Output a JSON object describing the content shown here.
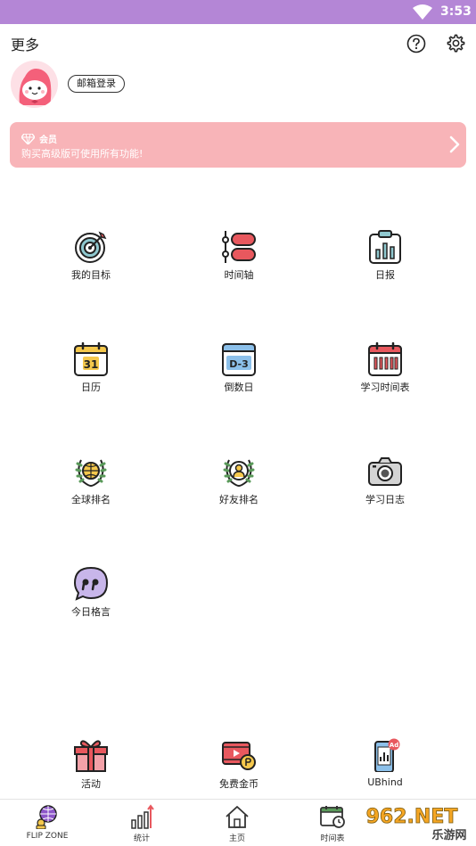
{
  "status": {
    "time": "3:53"
  },
  "header": {
    "title": "更多"
  },
  "profile": {
    "login_label": "邮箱登录"
  },
  "vip": {
    "label": "会员",
    "desc": "购买高级版可使用所有功能!"
  },
  "grid": [
    {
      "label": "我的目标",
      "icon": "target-icon"
    },
    {
      "label": "时间轴",
      "icon": "timeline-icon"
    },
    {
      "label": "日报",
      "icon": "daily-report-icon"
    },
    {
      "label": "日历",
      "icon": "calendar-icon"
    },
    {
      "label": "倒数日",
      "icon": "countdown-icon"
    },
    {
      "label": "学习时间表",
      "icon": "study-schedule-icon"
    },
    {
      "label": "全球排名",
      "icon": "global-rank-icon"
    },
    {
      "label": "好友排名",
      "icon": "friend-rank-icon"
    },
    {
      "label": "学习日志",
      "icon": "camera-icon"
    },
    {
      "label": "今日格言",
      "icon": "quote-icon"
    }
  ],
  "bottom": [
    {
      "label": "活动",
      "icon": "gift-icon"
    },
    {
      "label": "免费金币",
      "icon": "video-coin-icon"
    },
    {
      "label": "UBhind",
      "icon": "phone-ad-icon",
      "badge": "Ad"
    }
  ],
  "tabs": [
    {
      "label": "FLIP ZONE"
    },
    {
      "label": "统计"
    },
    {
      "label": "主页"
    },
    {
      "label": "时间表"
    }
  ],
  "calendar_day": "31",
  "countdown_text": "D-3",
  "watermark": {
    "text": "962.NET",
    "sub": "乐游网"
  },
  "colors": {
    "statusbar": "#b486d6",
    "vip": "#f8b4b8",
    "accent_red": "#e8585e"
  }
}
